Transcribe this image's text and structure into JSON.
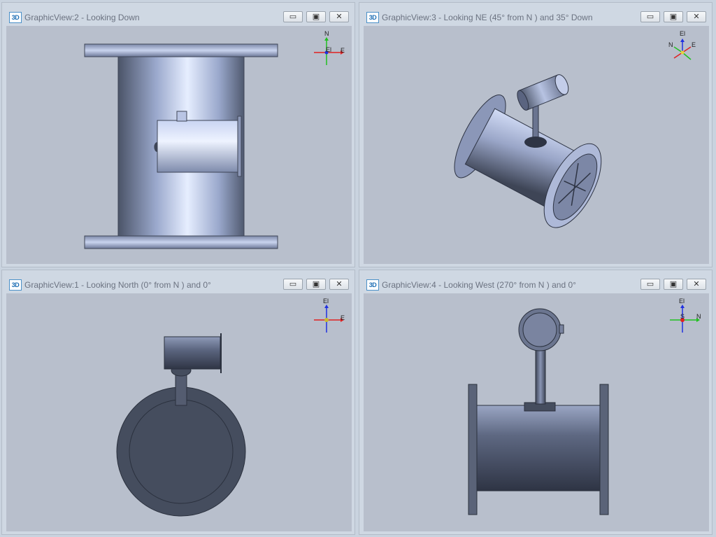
{
  "panes": [
    {
      "id": "view2",
      "badge": "3D",
      "title": "GraphicView:2 - Looking Down",
      "axes": [
        "N",
        "El",
        "E"
      ]
    },
    {
      "id": "view3",
      "badge": "3D",
      "title": "GraphicView:3 - Looking NE (45° from N ) and 35° Down",
      "axes": [
        "El",
        "N",
        "E"
      ]
    },
    {
      "id": "view1",
      "badge": "3D",
      "title": "GraphicView:1 - Looking North (0° from N ) and 0°",
      "axes": [
        "El",
        "E"
      ]
    },
    {
      "id": "view4",
      "badge": "3D",
      "title": "GraphicView:4 - Looking West (270° from N ) and 0°",
      "axes": [
        "El",
        "N",
        "S"
      ]
    }
  ],
  "window_buttons": {
    "minimize": "▭",
    "restore": "▣",
    "close": "✕"
  },
  "colors": {
    "viewport_bg": "#b8bfcc",
    "model_light": "#c8d4f0",
    "model_dark": "#454d5e",
    "axis_x": "#e02020",
    "axis_y": "#20c020",
    "axis_z": "#2030e0"
  }
}
